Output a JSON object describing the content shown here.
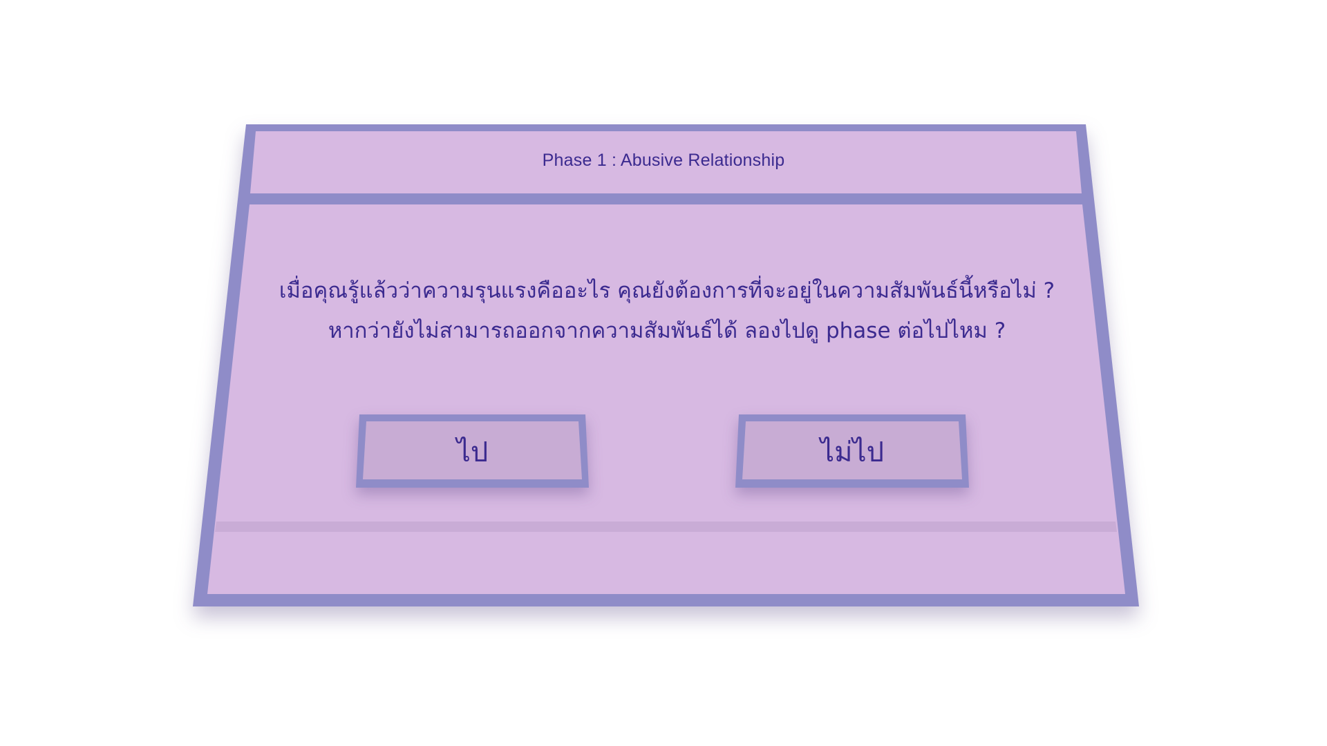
{
  "dialog": {
    "title": "Phase 1 : Abusive Relationship",
    "question_lines": [
      "เมื่อคุณรู้แล้วว่าความรุนแรงคืออะไร คุณยังต้องการที่จะอยู่ในความสัมพันธ์นี้หรือไม่ ?",
      "หากว่ายังไม่สามารถออกจากความสัมพันธ์ได้ ลองไปดู phase ต่อไปไหม ?"
    ],
    "buttons": {
      "go_label": "ไป",
      "no_go_label": "ไม่ไป"
    }
  },
  "colors": {
    "frame": "#8f8cc8",
    "panel_fill": "#d7b9e2",
    "button_fill": "#c8acd4",
    "text": "#3b2a8f",
    "background": "#ffffff"
  }
}
